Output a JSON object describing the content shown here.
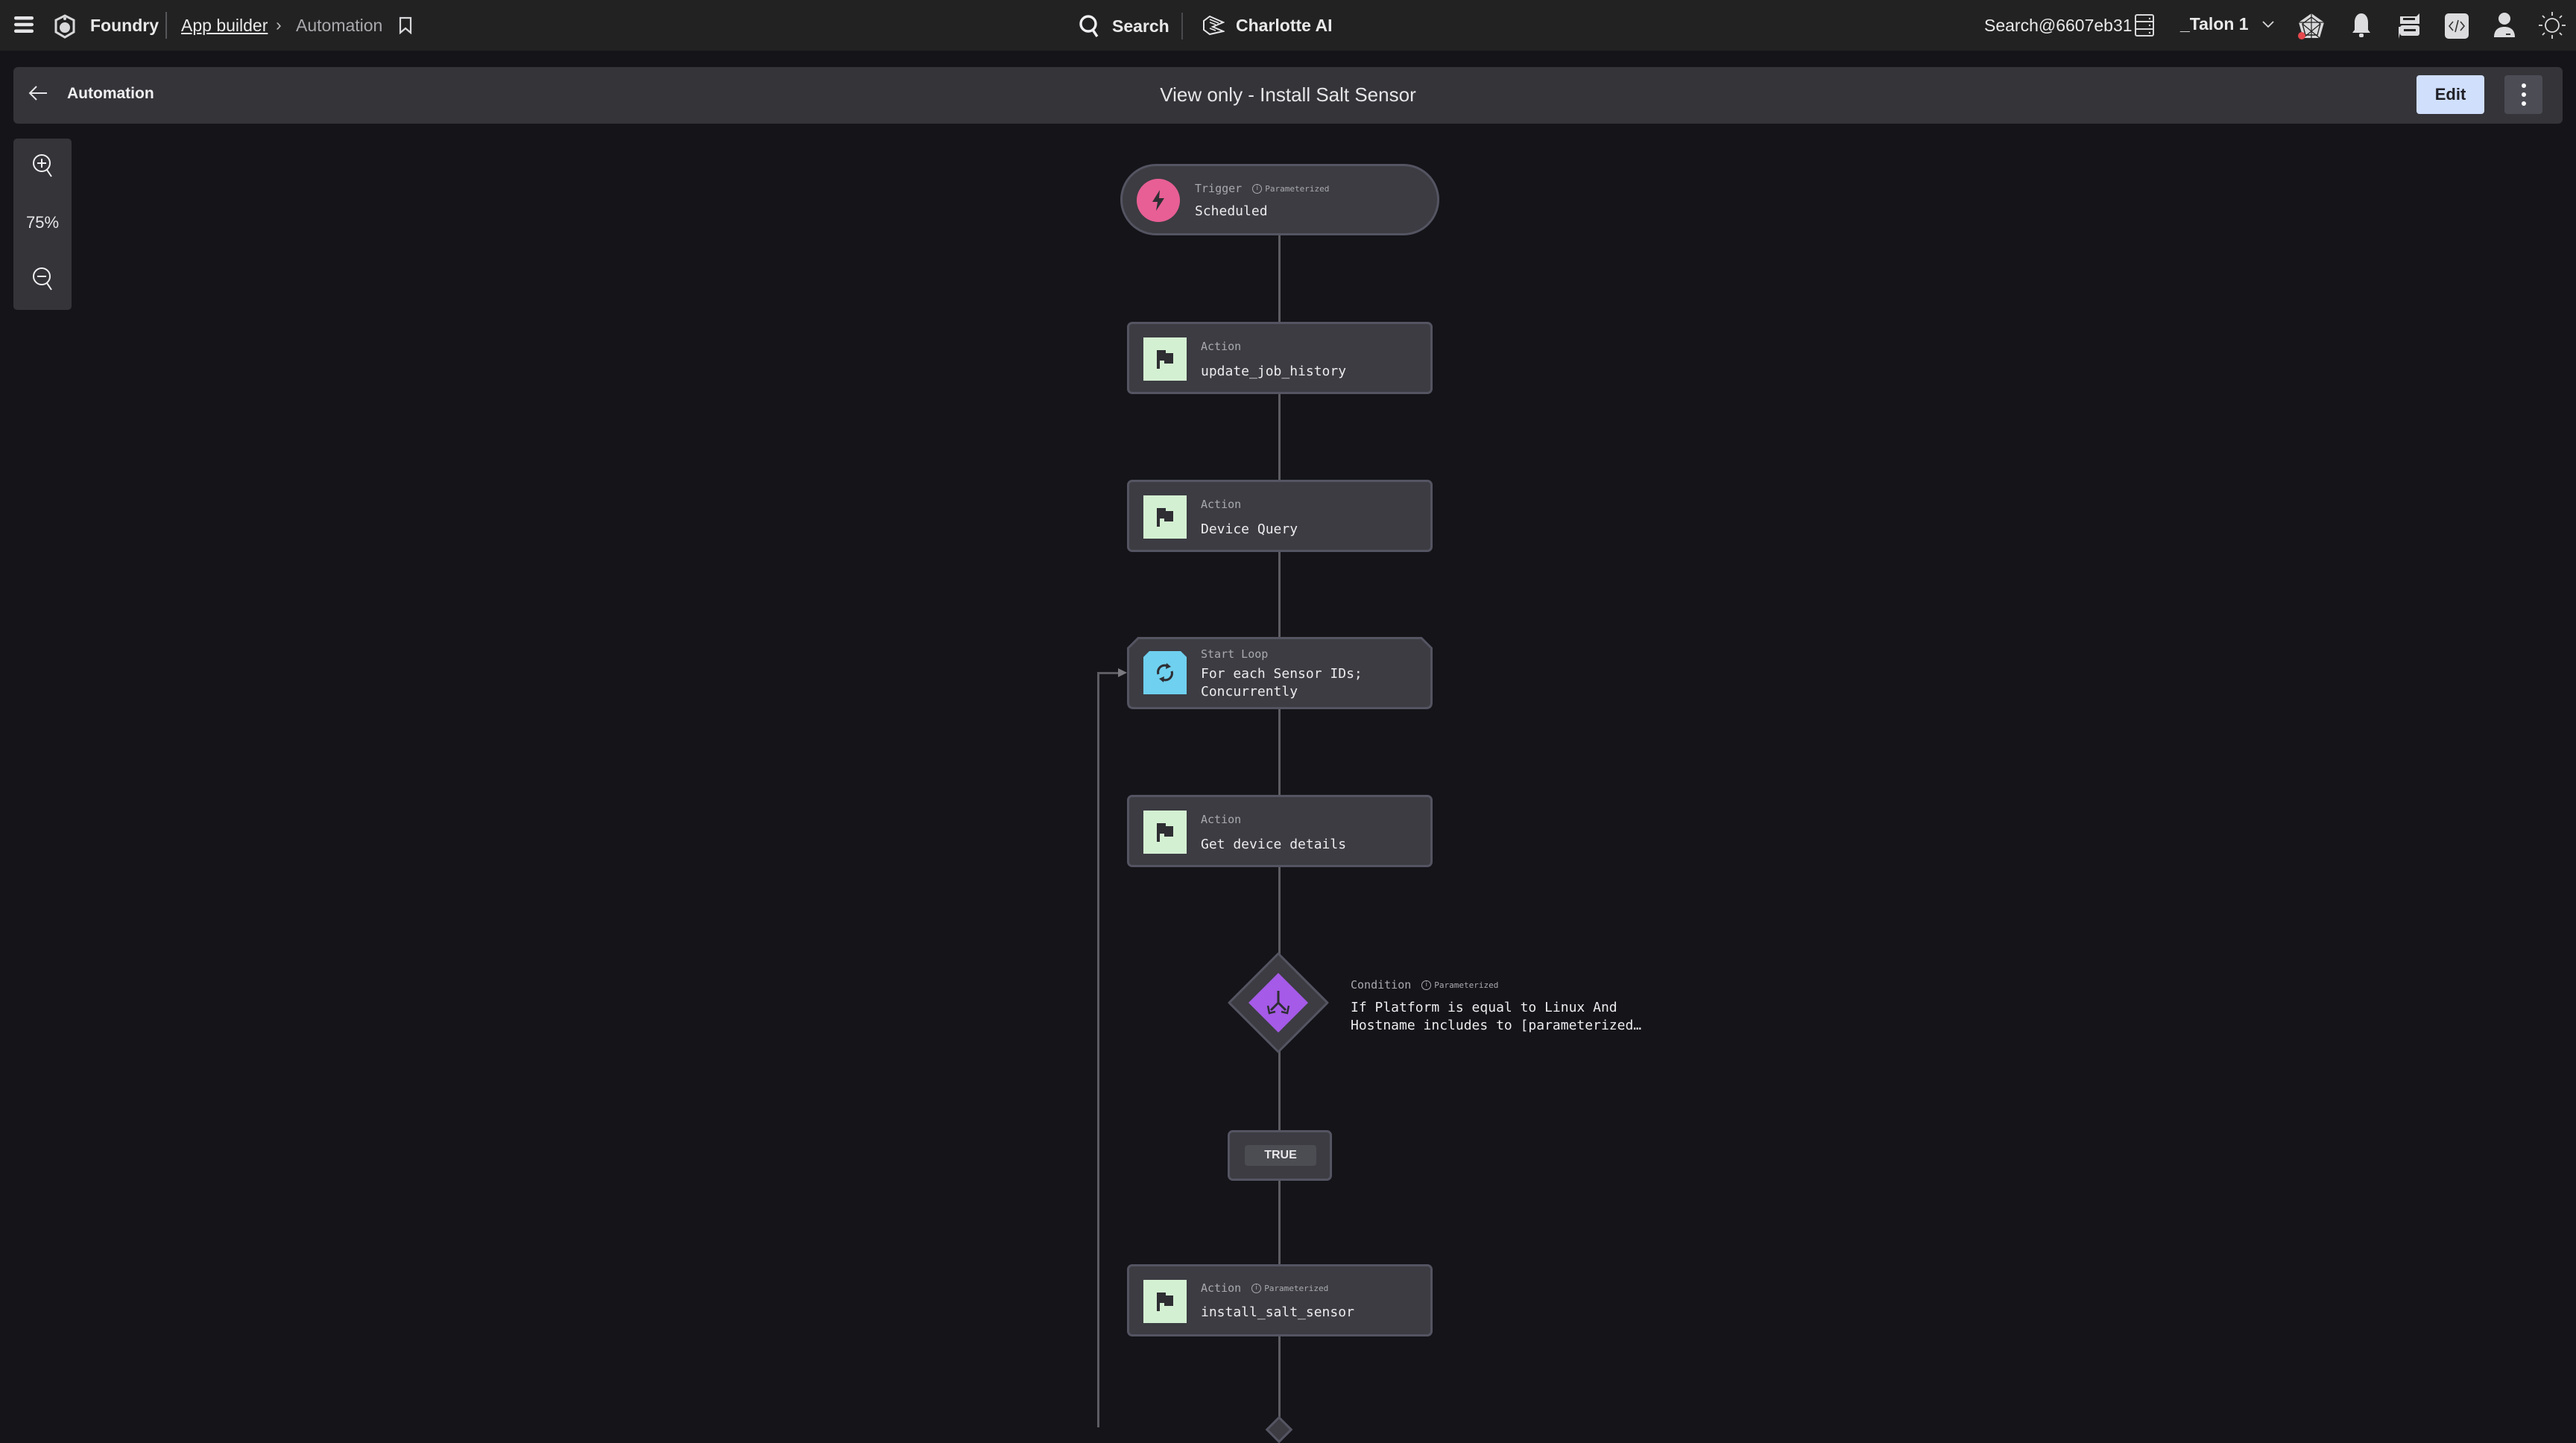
{
  "topbar": {
    "app_name": "Foundry",
    "breadcrumb": [
      {
        "label": "App builder",
        "link": true
      },
      {
        "label": "Automation",
        "link": false
      }
    ],
    "search_label": "Search",
    "ai_label": "Charlotte AI",
    "account_label": "Search@6607eb31",
    "tenant_label": "_Talon 1",
    "icons": [
      "menu-icon",
      "foundry-logo-icon",
      "bookmark-icon",
      "search-icon",
      "charlotte-ai-icon",
      "server-icon",
      "chevron-down-icon",
      "spider-web-icon",
      "bell-icon",
      "messages-icon",
      "code-icon",
      "user-icon",
      "sun-icon"
    ],
    "notification_dot_color": "#e5484d"
  },
  "header": {
    "back_label": "Automation",
    "title": "View only - Install Salt Sensor",
    "edit_label": "Edit",
    "edit_bg_color": "#d0dffc"
  },
  "zoom": {
    "level": "75%"
  },
  "workflow": {
    "trigger": {
      "type_label": "Trigger",
      "param_label": "Parameterized",
      "title": "Scheduled",
      "icon_color": "#e85f95"
    },
    "nodes": [
      {
        "type_label": "Action",
        "title": "update_job_history",
        "parameterized": false
      },
      {
        "type_label": "Action",
        "title": "Device Query",
        "parameterized": false
      },
      {
        "type_label": "Start Loop",
        "title_line1": "For each Sensor IDs;",
        "title_line2": "Concurrently",
        "icon_color": "#6fd0ef"
      },
      {
        "type_label": "Action",
        "title": "Get device details",
        "parameterized": false
      }
    ],
    "condition": {
      "type_label": "Condition",
      "param_label": "Parameterized",
      "title_line1": "If Platform is equal to Linux And",
      "title_line2": "Hostname includes to [parameterized…",
      "icon_color": "#a55ae8"
    },
    "branch_label": "TRUE",
    "final_action": {
      "type_label": "Action",
      "param_label": "Parameterized",
      "title": "install_salt_sensor"
    },
    "action_icon_color": "#d4f0d2"
  }
}
